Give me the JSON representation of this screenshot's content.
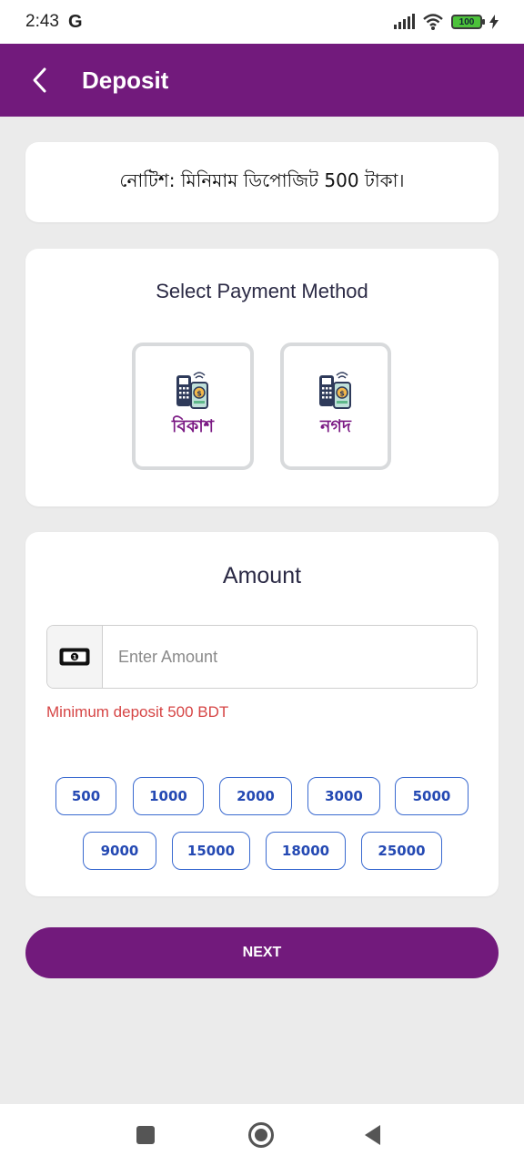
{
  "status_bar": {
    "time": "2:43",
    "carrier_icon": "G",
    "battery": "100"
  },
  "header": {
    "title": "Deposit"
  },
  "notice": {
    "text": "নোটিশ: মিনিমাম ডিপোজিট 500 টাকা।"
  },
  "payment": {
    "title": "Select Payment Method",
    "methods": [
      {
        "label": "বিকাশ",
        "icon": "payment-terminal-icon"
      },
      {
        "label": "নগদ",
        "icon": "payment-terminal-icon"
      }
    ]
  },
  "amount": {
    "title": "Amount",
    "placeholder": "Enter Amount",
    "hint": "Minimum deposit 500 BDT",
    "presets": [
      "500",
      "1000",
      "2000",
      "3000",
      "5000",
      "9000",
      "15000",
      "18000",
      "25000"
    ]
  },
  "next_button": {
    "label": "NEXT"
  },
  "colors": {
    "primary": "#721a7c",
    "chip_border": "#3a6ad0",
    "error": "#d64545",
    "background": "#ebebeb"
  }
}
